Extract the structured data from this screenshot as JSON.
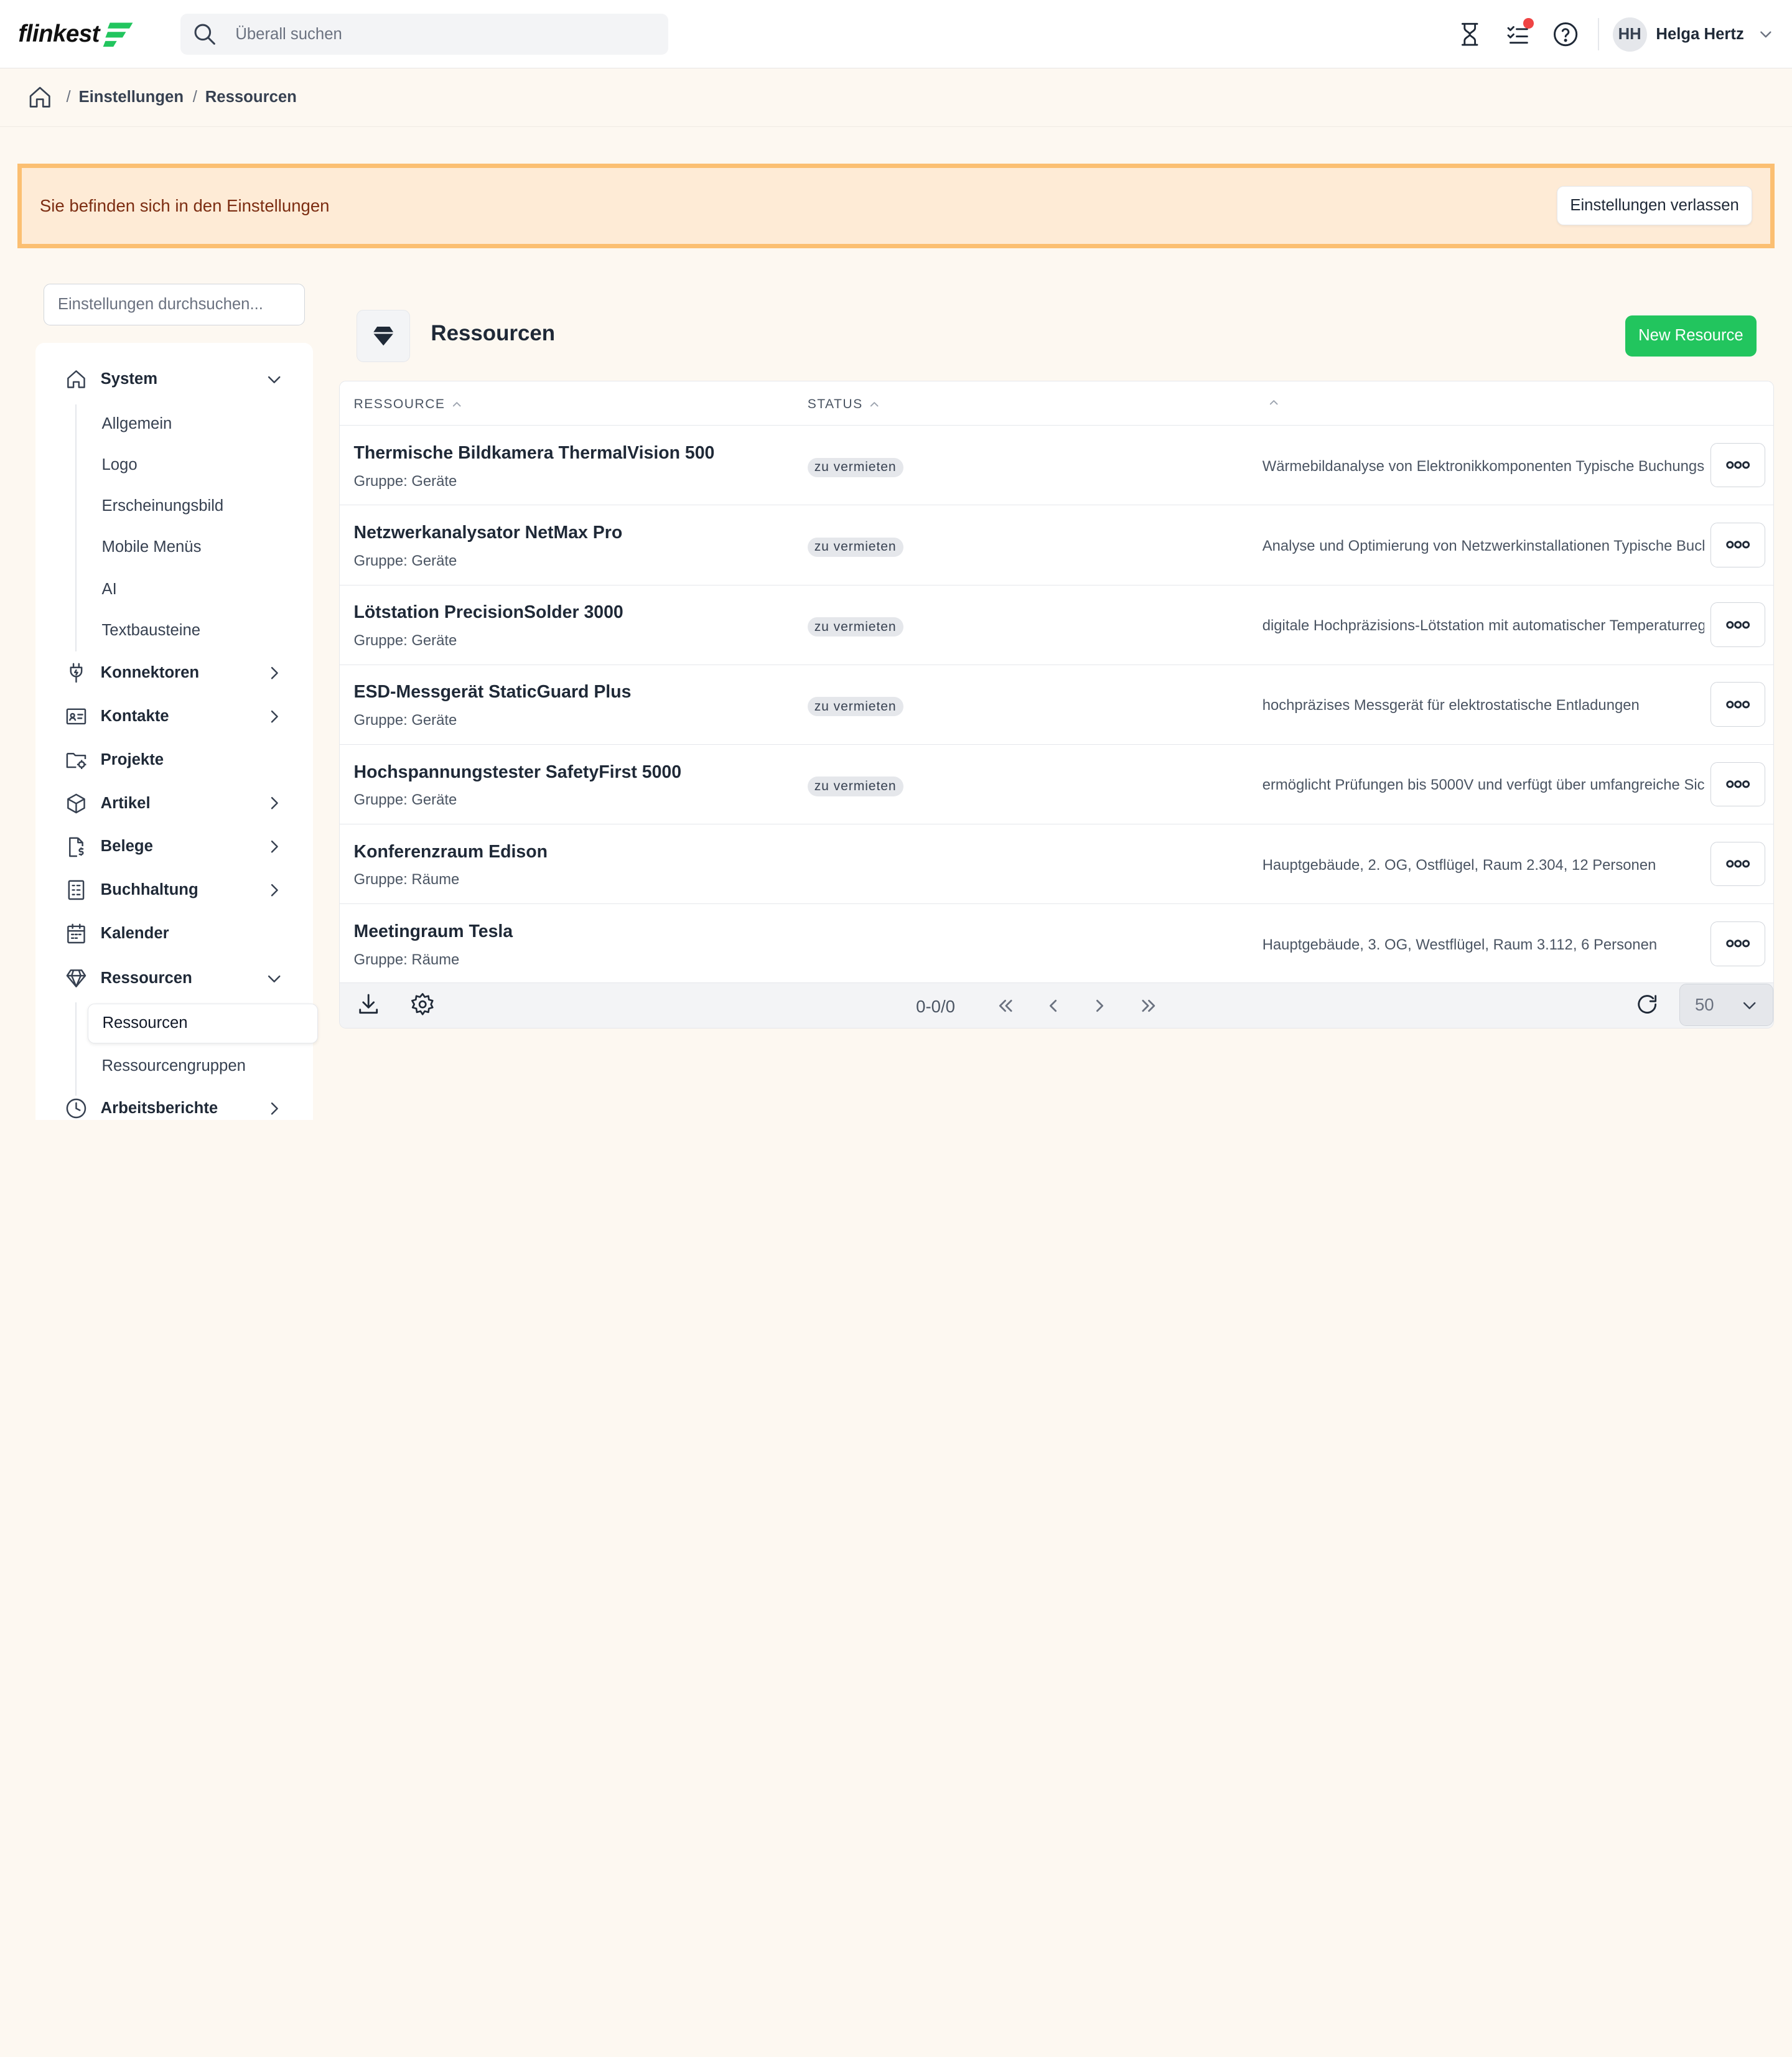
{
  "app": {
    "logo_text": "flinkest",
    "brand_color": "#22c55e",
    "search_placeholder": "Überall suchen"
  },
  "user": {
    "initials": "HH",
    "name": "Helga Hertz"
  },
  "topbar_icons": [
    "hourglass-icon",
    "tasks-icon",
    "help-icon"
  ],
  "breadcrumb": [
    "Einstellungen",
    "Ressourcen"
  ],
  "banner": {
    "message": "Sie befinden sich in den Einstellungen",
    "button": "Einstellungen verlassen"
  },
  "sidebar": {
    "search_placeholder": "Einstellungen durchsuchen...",
    "system": {
      "label": "System",
      "children": [
        "Allgemein",
        "Logo",
        "Erscheinungsbild",
        "Mobile Menüs",
        "AI",
        "Textbausteine"
      ]
    },
    "items": [
      {
        "label": "Konnektoren",
        "icon": "plug-icon",
        "chevron": true
      },
      {
        "label": "Kontakte",
        "icon": "contact-card-icon",
        "chevron": true
      },
      {
        "label": "Projekte",
        "icon": "folder-gear-icon",
        "chevron": false
      },
      {
        "label": "Artikel",
        "icon": "box-icon",
        "chevron": true
      },
      {
        "label": "Belege",
        "icon": "document-dollar-icon",
        "chevron": true
      },
      {
        "label": "Buchhaltung",
        "icon": "ledger-icon",
        "chevron": true
      },
      {
        "label": "Kalender",
        "icon": "calendar-icon",
        "chevron": false
      }
    ],
    "ressourcen": {
      "label": "Ressourcen",
      "children": [
        "Ressourcen",
        "Ressourcengruppen"
      ]
    },
    "last_item": {
      "label": "Arbeitsberichte"
    }
  },
  "main": {
    "title": "Ressourcen",
    "new_button": "New Resource",
    "columns": [
      "RESSOURCE",
      "STATUS"
    ],
    "rows": [
      {
        "name": "Thermische Bildkamera ThermalVision 500",
        "group": "Gruppe: Geräte",
        "status": "zu vermieten",
        "description": "Wärmebildanalyse von Elektronikkomponenten Typische Buchungsdauer"
      },
      {
        "name": "Netzwerkanalysator NetMax Pro",
        "group": "Gruppe: Geräte",
        "status": "zu vermieten",
        "description": "Analyse und Optimierung von Netzwerkinstallationen Typische Buchungsdauer"
      },
      {
        "name": "Lötstation PrecisionSolder 3000",
        "group": "Gruppe: Geräte",
        "status": "zu vermieten",
        "description": "digitale Hochpräzisions-Lötstation mit automatischer Temperaturregelung"
      },
      {
        "name": "ESD-Messgerät StaticGuard Plus",
        "group": "Gruppe: Geräte",
        "status": "zu vermieten",
        "description": "hochpräzises Messgerät für elektrostatische Entladungen"
      },
      {
        "name": "Hochspannungstester SafetyFirst 5000",
        "group": "Gruppe: Geräte",
        "status": "zu vermieten",
        "description": "ermöglicht Prüfungen bis 5000V und verfügt über umfangreiche Sicherheitsfunktionen"
      },
      {
        "name": "Konferenzraum Edison",
        "group": "Gruppe: Räume",
        "status": "",
        "description": "Hauptgebäude, 2. OG, Ostflügel, Raum 2.304, 12 Personen"
      },
      {
        "name": "Meetingraum Tesla",
        "group": "Gruppe: Räume",
        "status": "",
        "description": "Hauptgebäude, 3. OG, Westflügel, Raum 3.112, 6 Personen"
      }
    ],
    "pager": {
      "range": "0-0/0",
      "page_size": "50"
    }
  }
}
